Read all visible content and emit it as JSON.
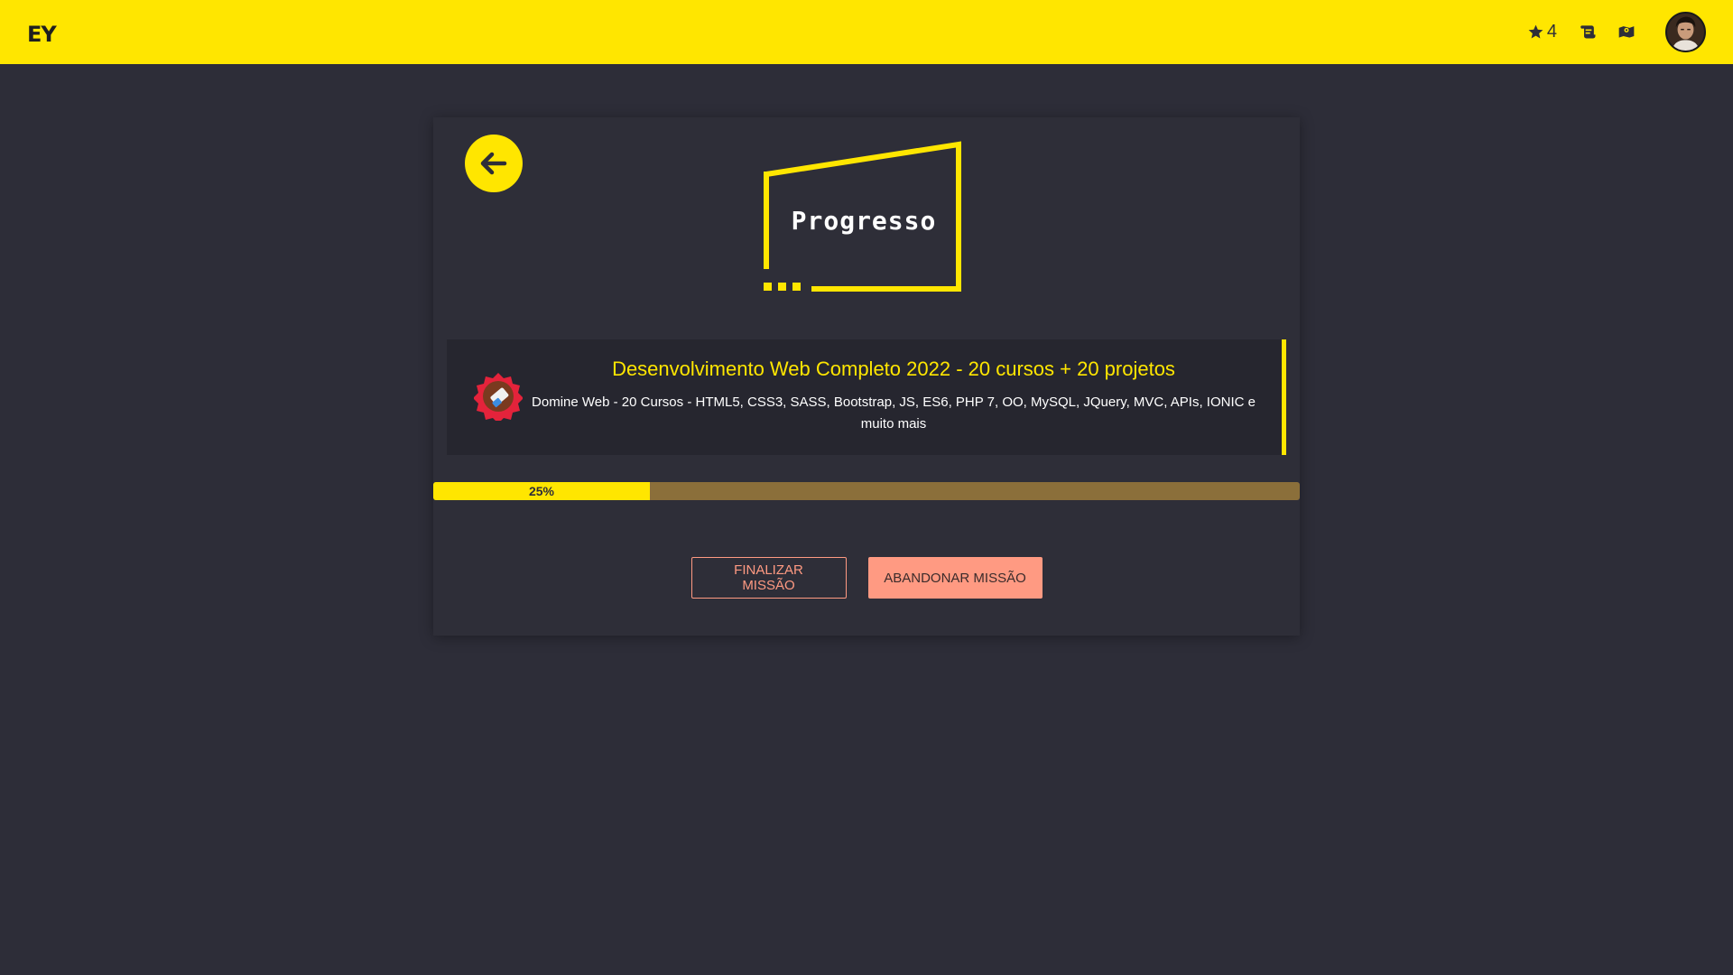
{
  "header": {
    "brand": "EY",
    "stars": "4",
    "icons": [
      "star-icon",
      "scroll-icon",
      "map-icon"
    ],
    "avatar": "user-avatar"
  },
  "page": {
    "title": "Progresso",
    "back_icon": "arrow-left-icon"
  },
  "mission": {
    "badge_icon": "eraser-badge-icon",
    "title": "Desenvolvimento Web Completo 2022 - 20 cursos + 20 projetos",
    "description": "Domine Web - 20 Cursos - HTML5, CSS3, SASS, Bootstrap, JS, ES6, PHP 7, OO, MySQL, JQuery, MVC, APIs, IONIC e muito mais"
  },
  "progress": {
    "value": 0.25,
    "label": "25%"
  },
  "actions": {
    "finish_label": "FINALIZAR MISSÃO",
    "abandon_label": "ABANDONAR MISSÃO"
  },
  "colors": {
    "accent": "#ffe600",
    "background": "#2d2d38",
    "progress_track": "#8b6f3a",
    "button": "#ff9a82"
  }
}
